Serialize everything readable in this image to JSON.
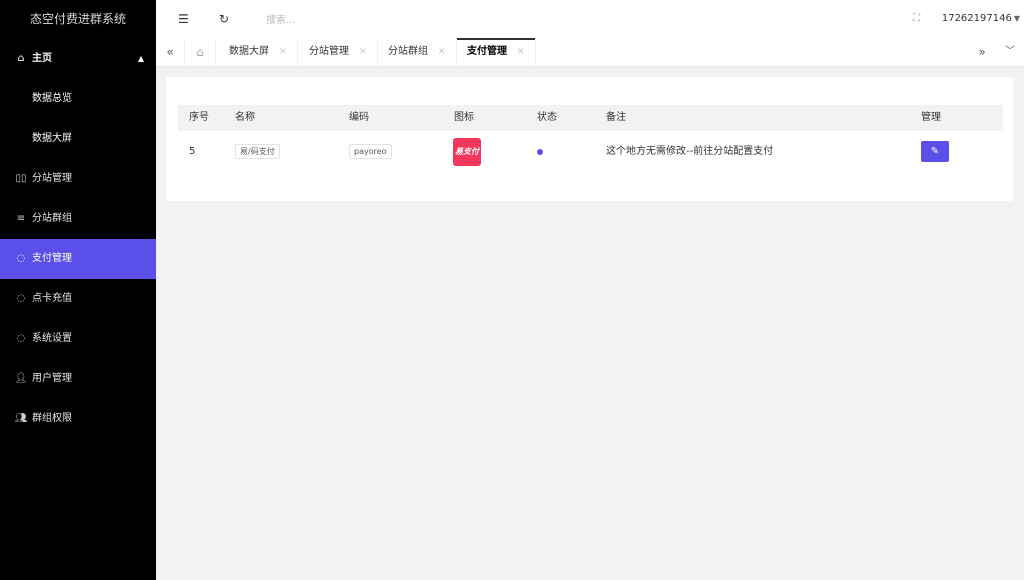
{
  "app": {
    "title": "态空付费进群系统"
  },
  "sidebar": {
    "items": [
      {
        "label": "主页",
        "icon": "home-icon"
      },
      {
        "label": "数据总览"
      },
      {
        "label": "数据大屏"
      },
      {
        "label": "分站管理",
        "icon": "columns-icon"
      },
      {
        "label": "分站群组",
        "icon": "sliders-icon"
      },
      {
        "label": "支付管理",
        "icon": "shield-icon",
        "active": true
      },
      {
        "label": "点卡充值",
        "icon": "shield-icon"
      },
      {
        "label": "系统设置",
        "icon": "shield-icon"
      },
      {
        "label": "用户管理",
        "icon": "user-icon"
      },
      {
        "label": "群组权限",
        "icon": "users-icon"
      }
    ],
    "active_color": "#5a4fe8"
  },
  "header": {
    "search_placeholder": "搜索...",
    "user": "17262197146"
  },
  "tabs": [
    {
      "label": "数据大屏"
    },
    {
      "label": "分站管理"
    },
    {
      "label": "分站群组"
    },
    {
      "label": "支付管理",
      "active": true
    }
  ],
  "table": {
    "headers": [
      "序号",
      "名称",
      "编码",
      "图标",
      "状态",
      "备注",
      "管理"
    ],
    "rows": [
      {
        "index": "5",
        "name": "易/码支付",
        "code": "payoreo",
        "icon_text": "易支付",
        "status": "enabled",
        "remark": "这个地方无需修改--前往分站配置支付"
      }
    ]
  }
}
